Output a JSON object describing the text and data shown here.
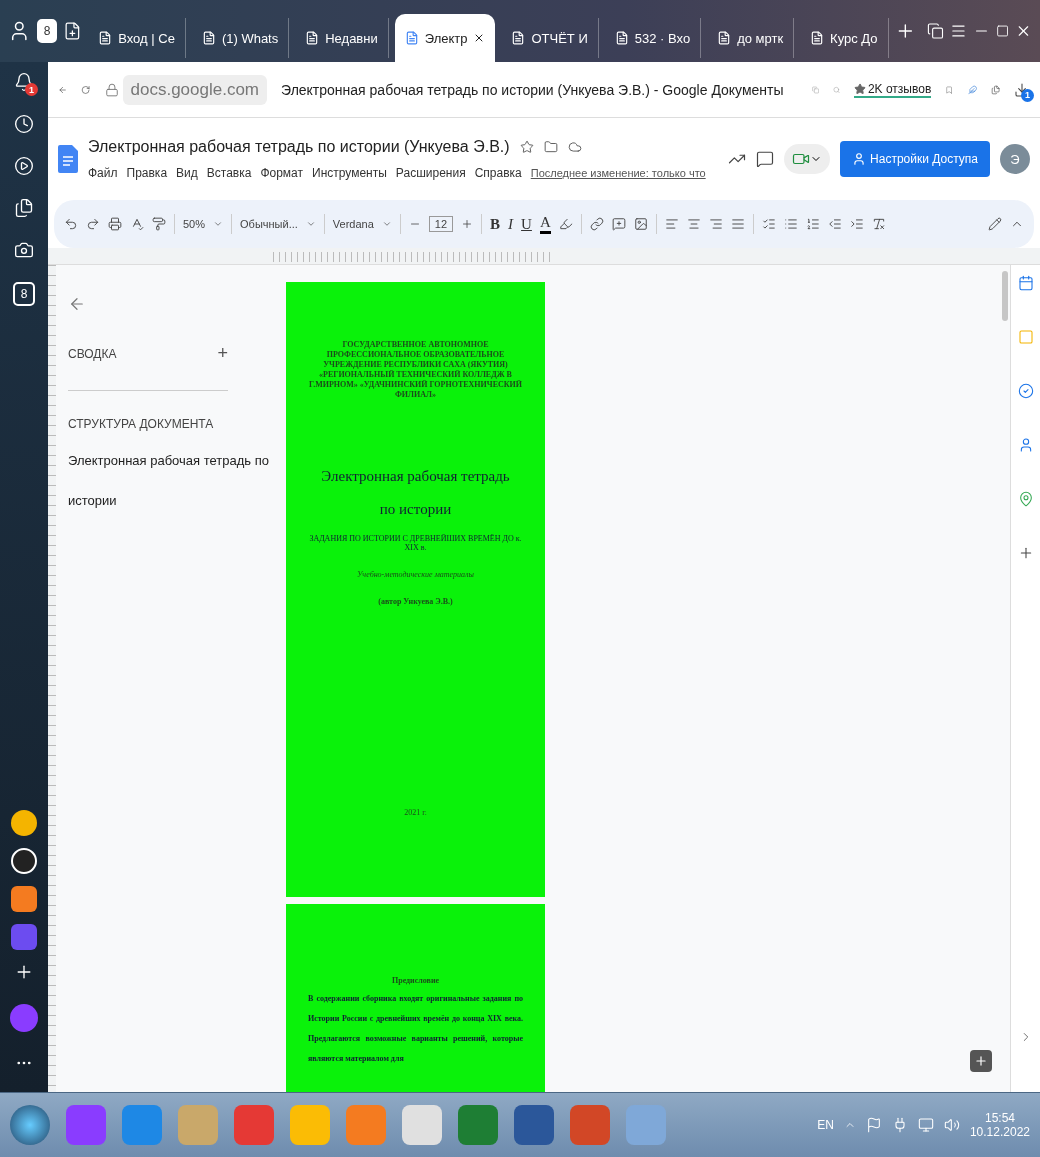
{
  "browser": {
    "home_badge": "8",
    "tabs": [
      {
        "label": "Вход | Се",
        "selected": false
      },
      {
        "label": "(1) Whats",
        "selected": false
      },
      {
        "label": "Недавни",
        "selected": false
      },
      {
        "label": "Электр",
        "selected": true
      },
      {
        "label": "ОТЧЁТ И",
        "selected": false
      },
      {
        "label": "532 · Вхо",
        "selected": false
      },
      {
        "label": "до мртк",
        "selected": false
      },
      {
        "label": "Курс До",
        "selected": false
      }
    ],
    "notification_badge": "1",
    "sidebar_badge": "8",
    "address": {
      "url": "docs.google.com",
      "page_title": "Электронная рабочая тетрадь по истории (Ункуева Э.В.) - Google Документы",
      "reviews": "2K отзывов",
      "download_badge": "1"
    }
  },
  "docs": {
    "title": "Электронная рабочая тетрадь по истории (Ункуева Э.В.)",
    "menu": [
      "Файл",
      "Правка",
      "Вид",
      "Вставка",
      "Формат",
      "Инструменты",
      "Расширения",
      "Справка"
    ],
    "last_edit": "Последнее изменение: только что",
    "share_button": "Настройки Доступа",
    "avatar": "Э",
    "toolbar": {
      "zoom": "50%",
      "style": "Обычный...",
      "font": "Verdana",
      "font_size": "12",
      "bold": "B",
      "italic": "I",
      "underline": "U",
      "text_color": "A"
    }
  },
  "outline": {
    "summary_label": "СВОДКА",
    "add": "+",
    "structure_label": "СТРУКТУРА ДОКУМЕНТА",
    "headings": [
      "Электронная рабочая тетрадь по истории"
    ]
  },
  "pages": [
    {
      "header": "ГОСУДАРСТВЕННОЕ АВТОНОМНОЕ ПРОФЕССИОНАЛЬНОЕ ОБРАЗОВАТЕЛЬНОЕ УЧРЕЖДЕНИЕ РЕСПУБЛИКИ САХА (ЯКУТИЯ) «РЕГИОНАЛЬНЫЙ ТЕХНИЧЕСКИЙ КОЛЛЕДЖ В Г.МИРНОМ» «УДАЧНИНСКИЙ ГОРНОТЕХНИЧЕСКИЙ ФИЛИАЛ»",
      "title": "Электронная рабочая тетрадь по истории",
      "subtitle": "ЗАДАНИЯ ПО ИСТОРИИ С ДРЕВНЕЙШИХ ВРЕМЁН ДО к. XIX в.",
      "kind_label": "Учебно-методические материалы",
      "author": "(автор Ункуева Э.В.)",
      "year": "2021 г."
    },
    {
      "heading": "Предисловие",
      "paragraph": "В содержании сборника входят оригинальные задания по Истории России с древнейших времён до конца XIX века. Предлагаются возможные варианты решений, которые являются материалом для"
    }
  ],
  "taskbar": {
    "language": "EN",
    "time": "15:54",
    "date": "10.12.2022"
  }
}
